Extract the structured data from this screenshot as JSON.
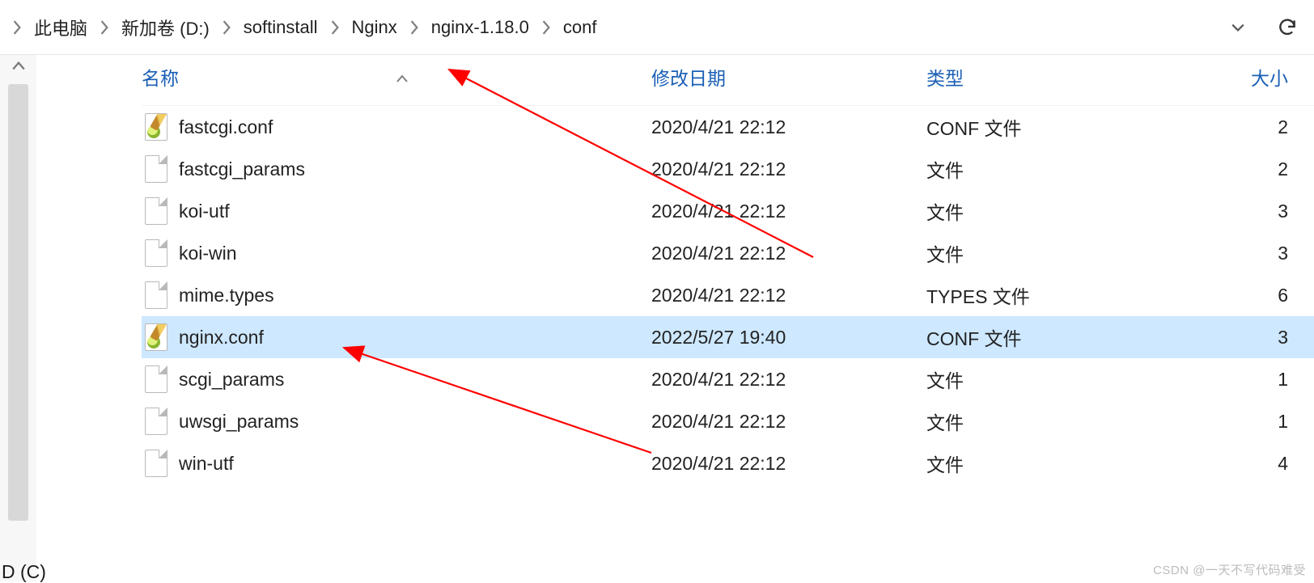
{
  "breadcrumb": {
    "items": [
      "此电脑",
      "新加卷 (D:)",
      "softinstall",
      "Nginx",
      "nginx-1.18.0",
      "conf"
    ]
  },
  "columns": {
    "name": "名称",
    "date": "修改日期",
    "type": "类型",
    "size": "大小"
  },
  "files": [
    {
      "name": "fastcgi.conf",
      "date": "2020/4/21 22:12",
      "type": "CONF 文件",
      "size": "2",
      "icon": "conf",
      "selected": false
    },
    {
      "name": "fastcgi_params",
      "date": "2020/4/21 22:12",
      "type": "文件",
      "size": "2",
      "icon": "plain",
      "selected": false
    },
    {
      "name": "koi-utf",
      "date": "2020/4/21 22:12",
      "type": "文件",
      "size": "3",
      "icon": "plain",
      "selected": false
    },
    {
      "name": "koi-win",
      "date": "2020/4/21 22:12",
      "type": "文件",
      "size": "3",
      "icon": "plain",
      "selected": false
    },
    {
      "name": "mime.types",
      "date": "2020/4/21 22:12",
      "type": "TYPES 文件",
      "size": "6",
      "icon": "plain",
      "selected": false
    },
    {
      "name": "nginx.conf",
      "date": "2022/5/27 19:40",
      "type": "CONF 文件",
      "size": "3",
      "icon": "conf",
      "selected": true
    },
    {
      "name": "scgi_params",
      "date": "2020/4/21 22:12",
      "type": "文件",
      "size": "1",
      "icon": "plain",
      "selected": false
    },
    {
      "name": "uwsgi_params",
      "date": "2020/4/21 22:12",
      "type": "文件",
      "size": "1",
      "icon": "plain",
      "selected": false
    },
    {
      "name": "win-utf",
      "date": "2020/4/21 22:12",
      "type": "文件",
      "size": "4",
      "icon": "plain",
      "selected": false
    }
  ],
  "watermark": "CSDN @一天不写代码难受",
  "cornerText": "D (C)"
}
